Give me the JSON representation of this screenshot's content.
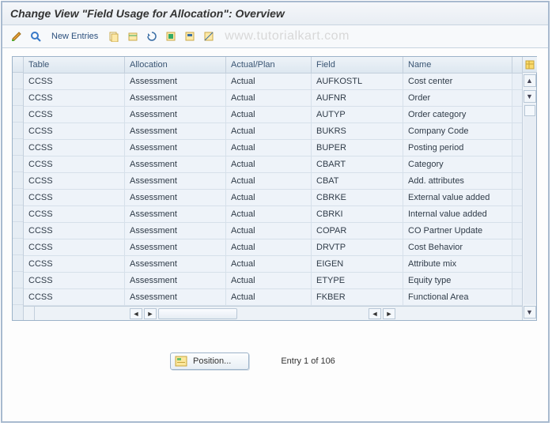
{
  "title": "Change View \"Field Usage for Allocation\": Overview",
  "toolbar": {
    "new_entries": "New Entries"
  },
  "watermark": "www.tutorialkart.com",
  "columns": {
    "table": "Table",
    "allocation": "Allocation",
    "actual_plan": "Actual/Plan",
    "field": "Field",
    "name": "Name"
  },
  "rows": [
    {
      "table": "CCSS",
      "allocation": "Assessment",
      "actual_plan": "Actual",
      "field": "AUFKOSTL",
      "name": "Cost center"
    },
    {
      "table": "CCSS",
      "allocation": "Assessment",
      "actual_plan": "Actual",
      "field": "AUFNR",
      "name": "Order"
    },
    {
      "table": "CCSS",
      "allocation": "Assessment",
      "actual_plan": "Actual",
      "field": "AUTYP",
      "name": "Order category"
    },
    {
      "table": "CCSS",
      "allocation": "Assessment",
      "actual_plan": "Actual",
      "field": "BUKRS",
      "name": "Company Code"
    },
    {
      "table": "CCSS",
      "allocation": "Assessment",
      "actual_plan": "Actual",
      "field": "BUPER",
      "name": "Posting period"
    },
    {
      "table": "CCSS",
      "allocation": "Assessment",
      "actual_plan": "Actual",
      "field": "CBART",
      "name": "Category"
    },
    {
      "table": "CCSS",
      "allocation": "Assessment",
      "actual_plan": "Actual",
      "field": "CBAT",
      "name": "Add. attributes"
    },
    {
      "table": "CCSS",
      "allocation": "Assessment",
      "actual_plan": "Actual",
      "field": "CBRKE",
      "name": "External value added"
    },
    {
      "table": "CCSS",
      "allocation": "Assessment",
      "actual_plan": "Actual",
      "field": "CBRKI",
      "name": "Internal value added"
    },
    {
      "table": "CCSS",
      "allocation": "Assessment",
      "actual_plan": "Actual",
      "field": "COPAR",
      "name": "CO Partner Update"
    },
    {
      "table": "CCSS",
      "allocation": "Assessment",
      "actual_plan": "Actual",
      "field": "DRVTP",
      "name": "Cost Behavior"
    },
    {
      "table": "CCSS",
      "allocation": "Assessment",
      "actual_plan": "Actual",
      "field": "EIGEN",
      "name": "Attribute mix"
    },
    {
      "table": "CCSS",
      "allocation": "Assessment",
      "actual_plan": "Actual",
      "field": "ETYPE",
      "name": "Equity type"
    },
    {
      "table": "CCSS",
      "allocation": "Assessment",
      "actual_plan": "Actual",
      "field": "FKBER",
      "name": "Functional Area"
    }
  ],
  "footer": {
    "position_label": "Position...",
    "entry_status": "Entry 1 of 106"
  }
}
